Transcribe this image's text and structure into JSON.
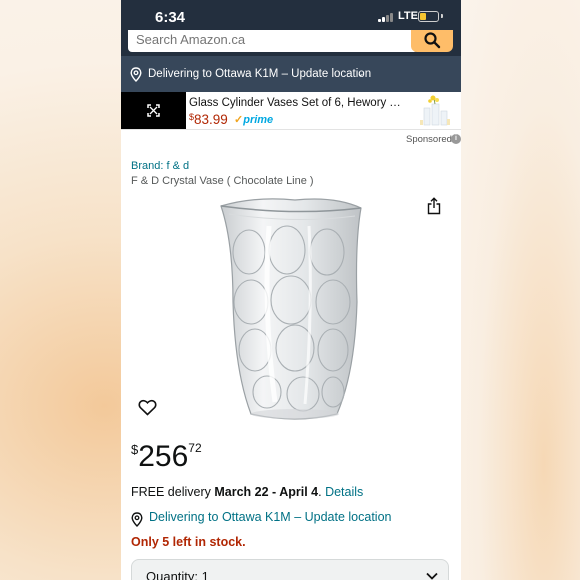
{
  "status_bar": {
    "time": "6:34",
    "network": "LTE",
    "battery_level": 0.35
  },
  "search": {
    "placeholder": "Search Amazon.ca"
  },
  "delivery_bar": {
    "text": "Delivering to Ottawa K1M – Update location"
  },
  "ad": {
    "title": "Glass Cylinder Vases Set of 6, Hewory Tall...",
    "currency": "$",
    "price": "83.99",
    "prime_label": "prime"
  },
  "sponsored": {
    "label": "Sponsored",
    "info_icon": "i"
  },
  "product": {
    "brand": "Brand: f & d",
    "title": "F & D Crystal Vase ( Chocolate Line )",
    "price_currency": "$",
    "price_whole": "256",
    "price_fraction": "72"
  },
  "delivery": {
    "prefix": "FREE delivery ",
    "dates": "March 22 - April 4",
    "period": ". ",
    "details_link": "Details",
    "location": "Delivering to Ottawa K1M – Update location",
    "stock": "Only 5 left in stock."
  },
  "quantity": {
    "label": "Quantity: 1"
  },
  "colors": {
    "header": "#232f3e",
    "delivery_bar": "#37475a",
    "search_button": "#febd69",
    "link": "#007185",
    "price_red": "#b12704",
    "prime": "#00a8e1"
  }
}
